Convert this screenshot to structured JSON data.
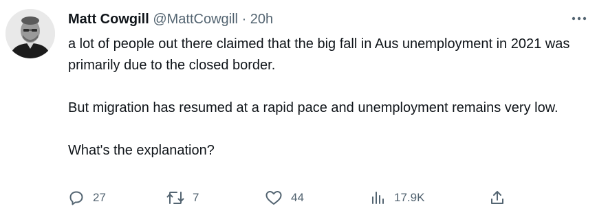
{
  "tweet": {
    "author_name": "Matt Cowgill",
    "handle": "@MattCowgill",
    "separator": "·",
    "time": "20h",
    "paragraphs": [
      "a lot of people out there claimed that the big fall in Aus unemployment in 2021 was primarily due to the closed border.",
      "But migration has resumed at a rapid pace and unemployment remains very low.",
      "What's the explanation?"
    ]
  },
  "actions": {
    "replies": {
      "icon": "reply-icon",
      "count": "27"
    },
    "retweets": {
      "icon": "retweet-icon",
      "count": "7"
    },
    "likes": {
      "icon": "heart-icon",
      "count": "44"
    },
    "views": {
      "icon": "views-icon",
      "count": "17.9K"
    },
    "share": {
      "icon": "share-icon"
    }
  },
  "more_icon": "more-options-icon",
  "colors": {
    "text": "#0f1419",
    "secondary": "#536471",
    "background": "#ffffff"
  }
}
